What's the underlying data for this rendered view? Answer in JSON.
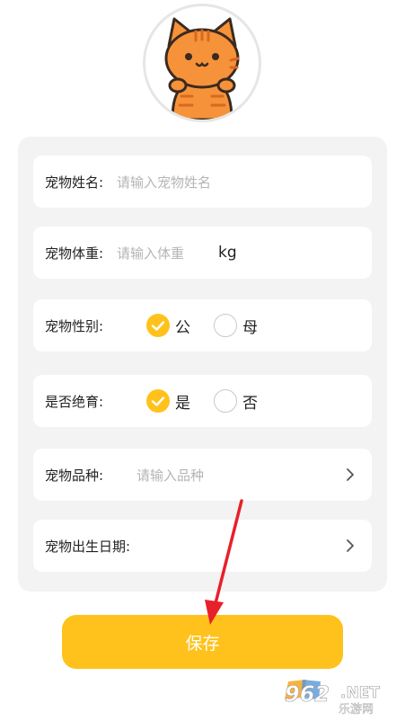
{
  "form": {
    "name": {
      "label": "宠物姓名:",
      "placeholder": "请输入宠物姓名"
    },
    "weight": {
      "label": "宠物体重:",
      "placeholder": "请输入体重",
      "unit": "kg"
    },
    "gender": {
      "label": "宠物性别:",
      "options": [
        "公",
        "母"
      ],
      "selected": "公"
    },
    "neutered": {
      "label": "是否绝育:",
      "options": [
        "是",
        "否"
      ],
      "selected": "是"
    },
    "breed": {
      "label": "宠物品种:",
      "placeholder": "请输入品种"
    },
    "birthday": {
      "label": "宠物出生日期:"
    }
  },
  "save_label": "保存",
  "watermark": {
    "brand": "962",
    "suffix": ".NET",
    "subtitle": "乐游网"
  },
  "colors": {
    "accent": "#ffc21c",
    "annotation_arrow": "#e8202a",
    "card_bg": "#f3f3f3"
  }
}
